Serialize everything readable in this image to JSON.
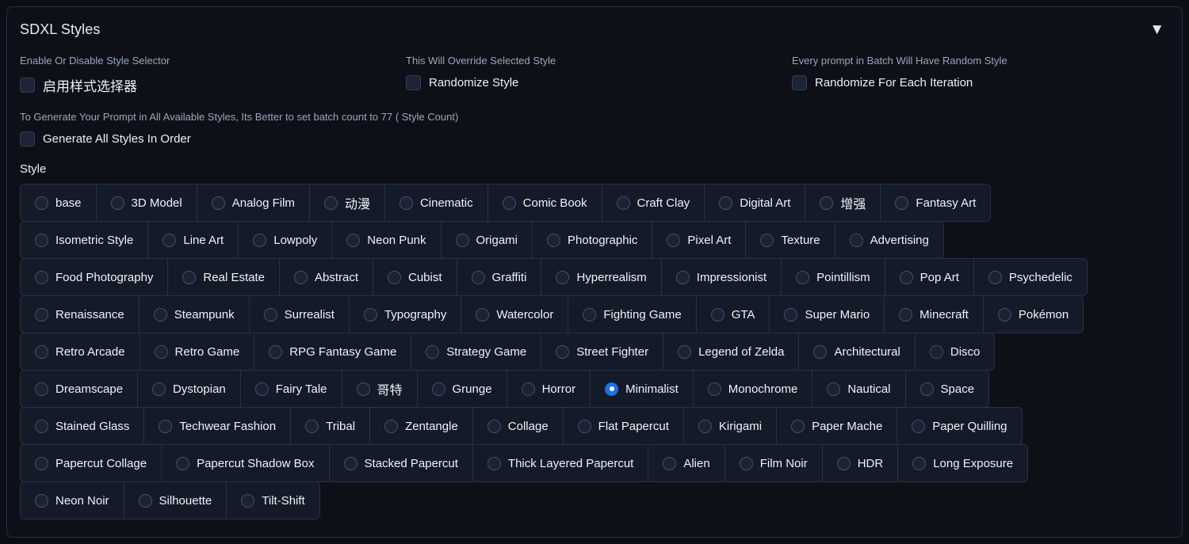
{
  "panel": {
    "title": "SDXL Styles",
    "collapse_icon": "chevron-down-icon",
    "collapse_glyph": "▼"
  },
  "options": [
    {
      "description": "Enable Or Disable Style Selector",
      "label": "启用样式选择器",
      "checked": false,
      "cjk": true
    },
    {
      "description": "This Will Override Selected Style",
      "label": "Randomize Style",
      "checked": false,
      "cjk": false
    },
    {
      "description": "Every prompt in Batch Will Have Random Style",
      "label": "Randomize For Each Iteration",
      "checked": false,
      "cjk": false
    }
  ],
  "order_option": {
    "description": "To Generate Your Prompt in All Available Styles, Its Better to set batch count to 77 ( Style Count)",
    "label": "Generate All Styles In Order",
    "checked": false
  },
  "style_group": {
    "label": "Style",
    "selected": "Minimalist",
    "selected_color": "#1f6fe8",
    "count": 77,
    "rows": [
      [
        "base",
        "3D Model",
        "Analog Film",
        "动漫",
        "Cinematic",
        "Comic Book",
        "Craft Clay",
        "Digital Art",
        "增强",
        "Fantasy Art"
      ],
      [
        "Isometric Style",
        "Line Art",
        "Lowpoly",
        "Neon Punk",
        "Origami",
        "Photographic",
        "Pixel Art",
        "Texture",
        "Advertising"
      ],
      [
        "Food Photography",
        "Real Estate",
        "Abstract",
        "Cubist",
        "Graffiti",
        "Hyperrealism",
        "Impressionist",
        "Pointillism",
        "Pop Art",
        "Psychedelic"
      ],
      [
        "Renaissance",
        "Steampunk",
        "Surrealist",
        "Typography",
        "Watercolor",
        "Fighting Game",
        "GTA",
        "Super Mario",
        "Minecraft",
        "Pokémon"
      ],
      [
        "Retro Arcade",
        "Retro Game",
        "RPG Fantasy Game",
        "Strategy Game",
        "Street Fighter",
        "Legend of Zelda",
        "Architectural",
        "Disco"
      ],
      [
        "Dreamscape",
        "Dystopian",
        "Fairy Tale",
        "哥特",
        "Grunge",
        "Horror",
        "Minimalist",
        "Monochrome",
        "Nautical",
        "Space"
      ],
      [
        "Stained Glass",
        "Techwear Fashion",
        "Tribal",
        "Zentangle",
        "Collage",
        "Flat Papercut",
        "Kirigami",
        "Paper Mache",
        "Paper Quilling"
      ],
      [
        "Papercut Collage",
        "Papercut Shadow Box",
        "Stacked Papercut",
        "Thick Layered Papercut",
        "Alien",
        "Film Noir",
        "HDR",
        "Long Exposure"
      ],
      [
        "Neon Noir",
        "Silhouette",
        "Tilt-Shift"
      ]
    ]
  }
}
